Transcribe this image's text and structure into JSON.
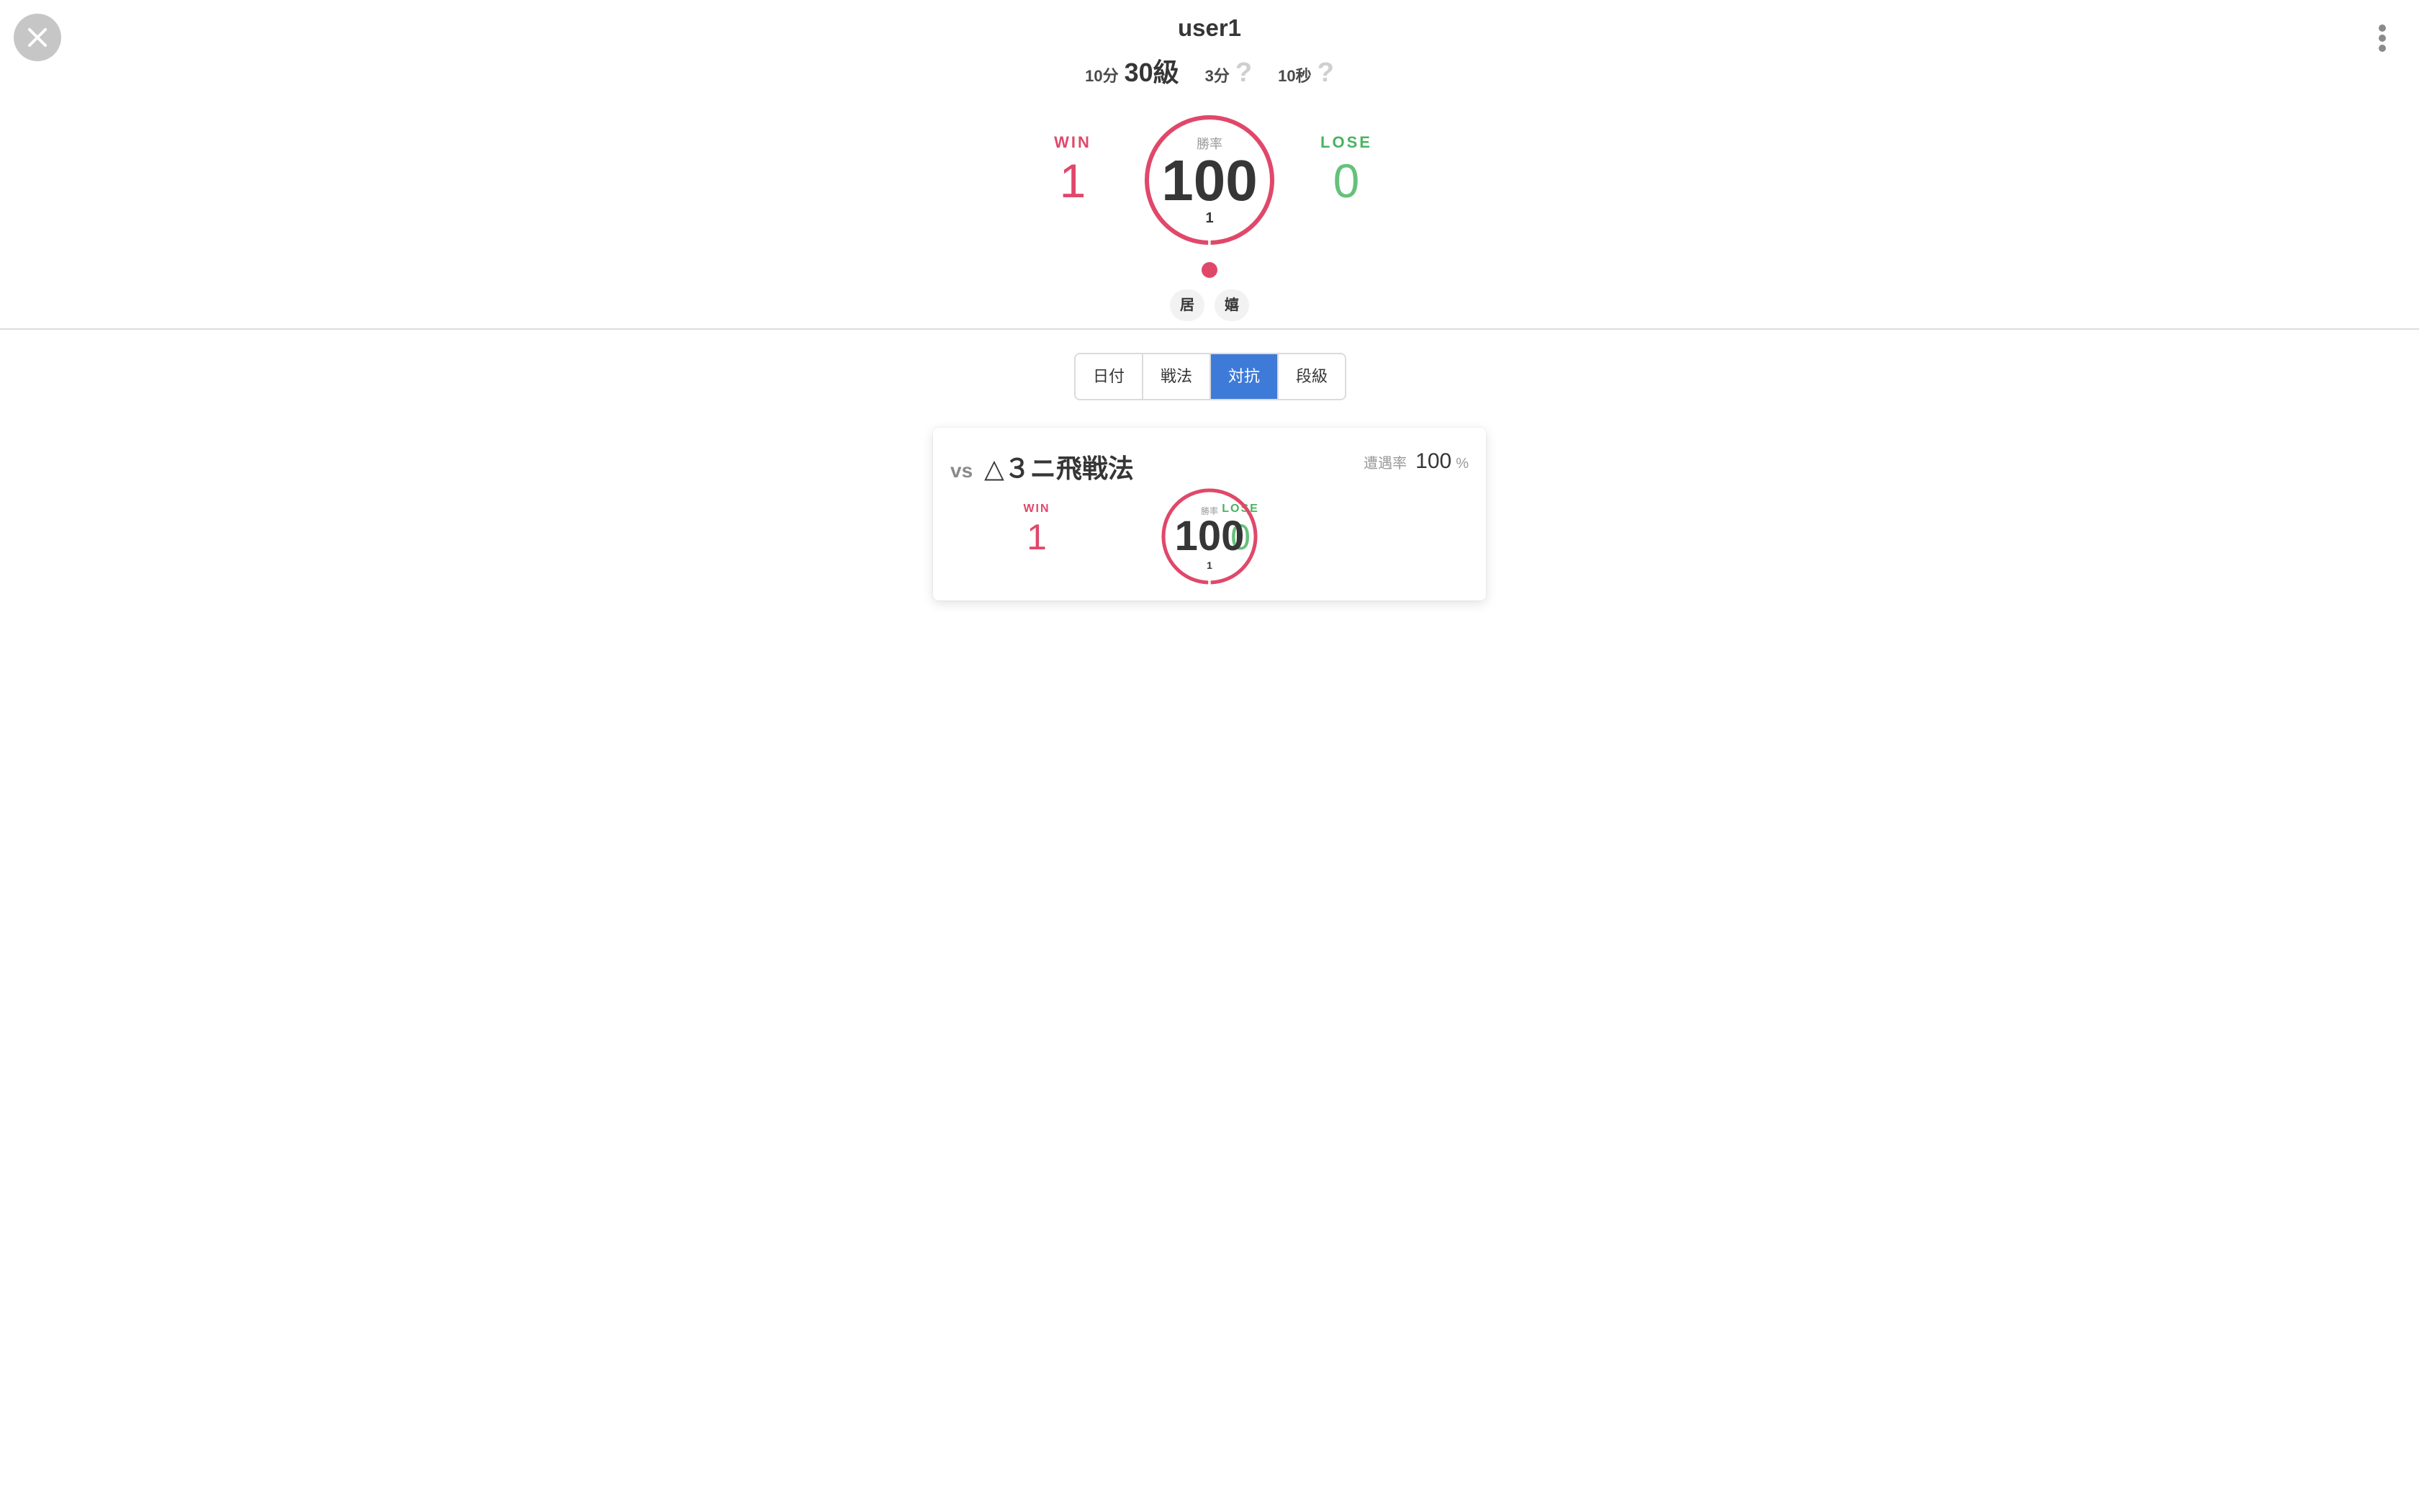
{
  "user": {
    "name": "user1",
    "ranks": [
      {
        "rule": "10分",
        "grade": "30級",
        "known": true
      },
      {
        "rule": "3分",
        "grade": "?",
        "known": false
      },
      {
        "rule": "10秒",
        "grade": "?",
        "known": false
      }
    ]
  },
  "summary": {
    "win_label": "WIN",
    "win_count": "1",
    "lose_label": "LOSE",
    "lose_count": "0",
    "rate_label": "勝率",
    "rate_value": "100",
    "rate_total": "1",
    "rate_fraction": 1.0
  },
  "recent_results": [
    "win"
  ],
  "style_tags": [
    "居",
    "嬉"
  ],
  "tabs": [
    {
      "label": "日付",
      "active": false
    },
    {
      "label": "戦法",
      "active": false
    },
    {
      "label": "対抗",
      "active": true
    },
    {
      "label": "段級",
      "active": false
    }
  ],
  "cards": [
    {
      "vs_label": "vs",
      "opponent": "△３ニ飛戦法",
      "encounter_label": "遭遇率",
      "encounter_value": "100",
      "encounter_unit": "%",
      "win_label": "WIN",
      "win_count": "1",
      "lose_label": "LOSE",
      "lose_count": "0",
      "rate_label": "勝率",
      "rate_value": "100",
      "rate_total": "1",
      "rate_fraction": 1.0
    }
  ],
  "colors": {
    "win": "#e0486a",
    "lose": "#48b460",
    "active_tab": "#3e7bd8",
    "close_button": "#c6c6c6"
  },
  "icons": {
    "close": "close-icon",
    "more": "more-vertical-icon"
  }
}
